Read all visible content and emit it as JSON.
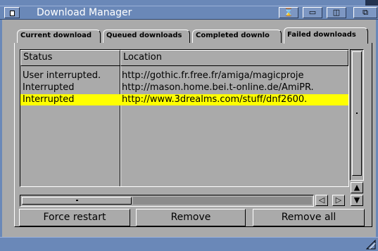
{
  "window": {
    "title": "Download Manager",
    "gadgets": [
      {
        "name": "zoom-gadget",
        "symbol": "⌛"
      },
      {
        "name": "iconify-gadget",
        "symbol": "▭"
      },
      {
        "name": "depth-gadget",
        "symbol": "◫"
      },
      {
        "name": "window-resize-gadget",
        "symbol": "⧉"
      }
    ]
  },
  "tabs": [
    {
      "label": "Current download",
      "active": false
    },
    {
      "label": "Queued downloads",
      "active": false
    },
    {
      "label": "Completed downlo",
      "active": false
    },
    {
      "label": "Failed downloads",
      "active": true
    }
  ],
  "table": {
    "columns": [
      "Status",
      "Location"
    ],
    "rows": [
      {
        "status": "User interrupted.",
        "location": "http://gothic.fr.free.fr/amiga/magicproje",
        "selected": false
      },
      {
        "status": "Interrupted",
        "location": "http://mason.home.bei.t-online.de/AmiPR.",
        "selected": false
      },
      {
        "status": "Interrupted",
        "location": "http://www.3drealms.com/stuff/dnf2600.",
        "selected": true
      }
    ]
  },
  "scroll": {
    "up_symbol": "▲",
    "down_symbol": "▼",
    "left_symbol": "◁",
    "right_symbol": "▷"
  },
  "buttons": {
    "force_restart": "Force restart",
    "remove": "Remove",
    "remove_all": "Remove all"
  },
  "colors": {
    "window_bg": "#aaaaaa",
    "titlebar": "#6a88b8",
    "selection": "#ffff00"
  }
}
